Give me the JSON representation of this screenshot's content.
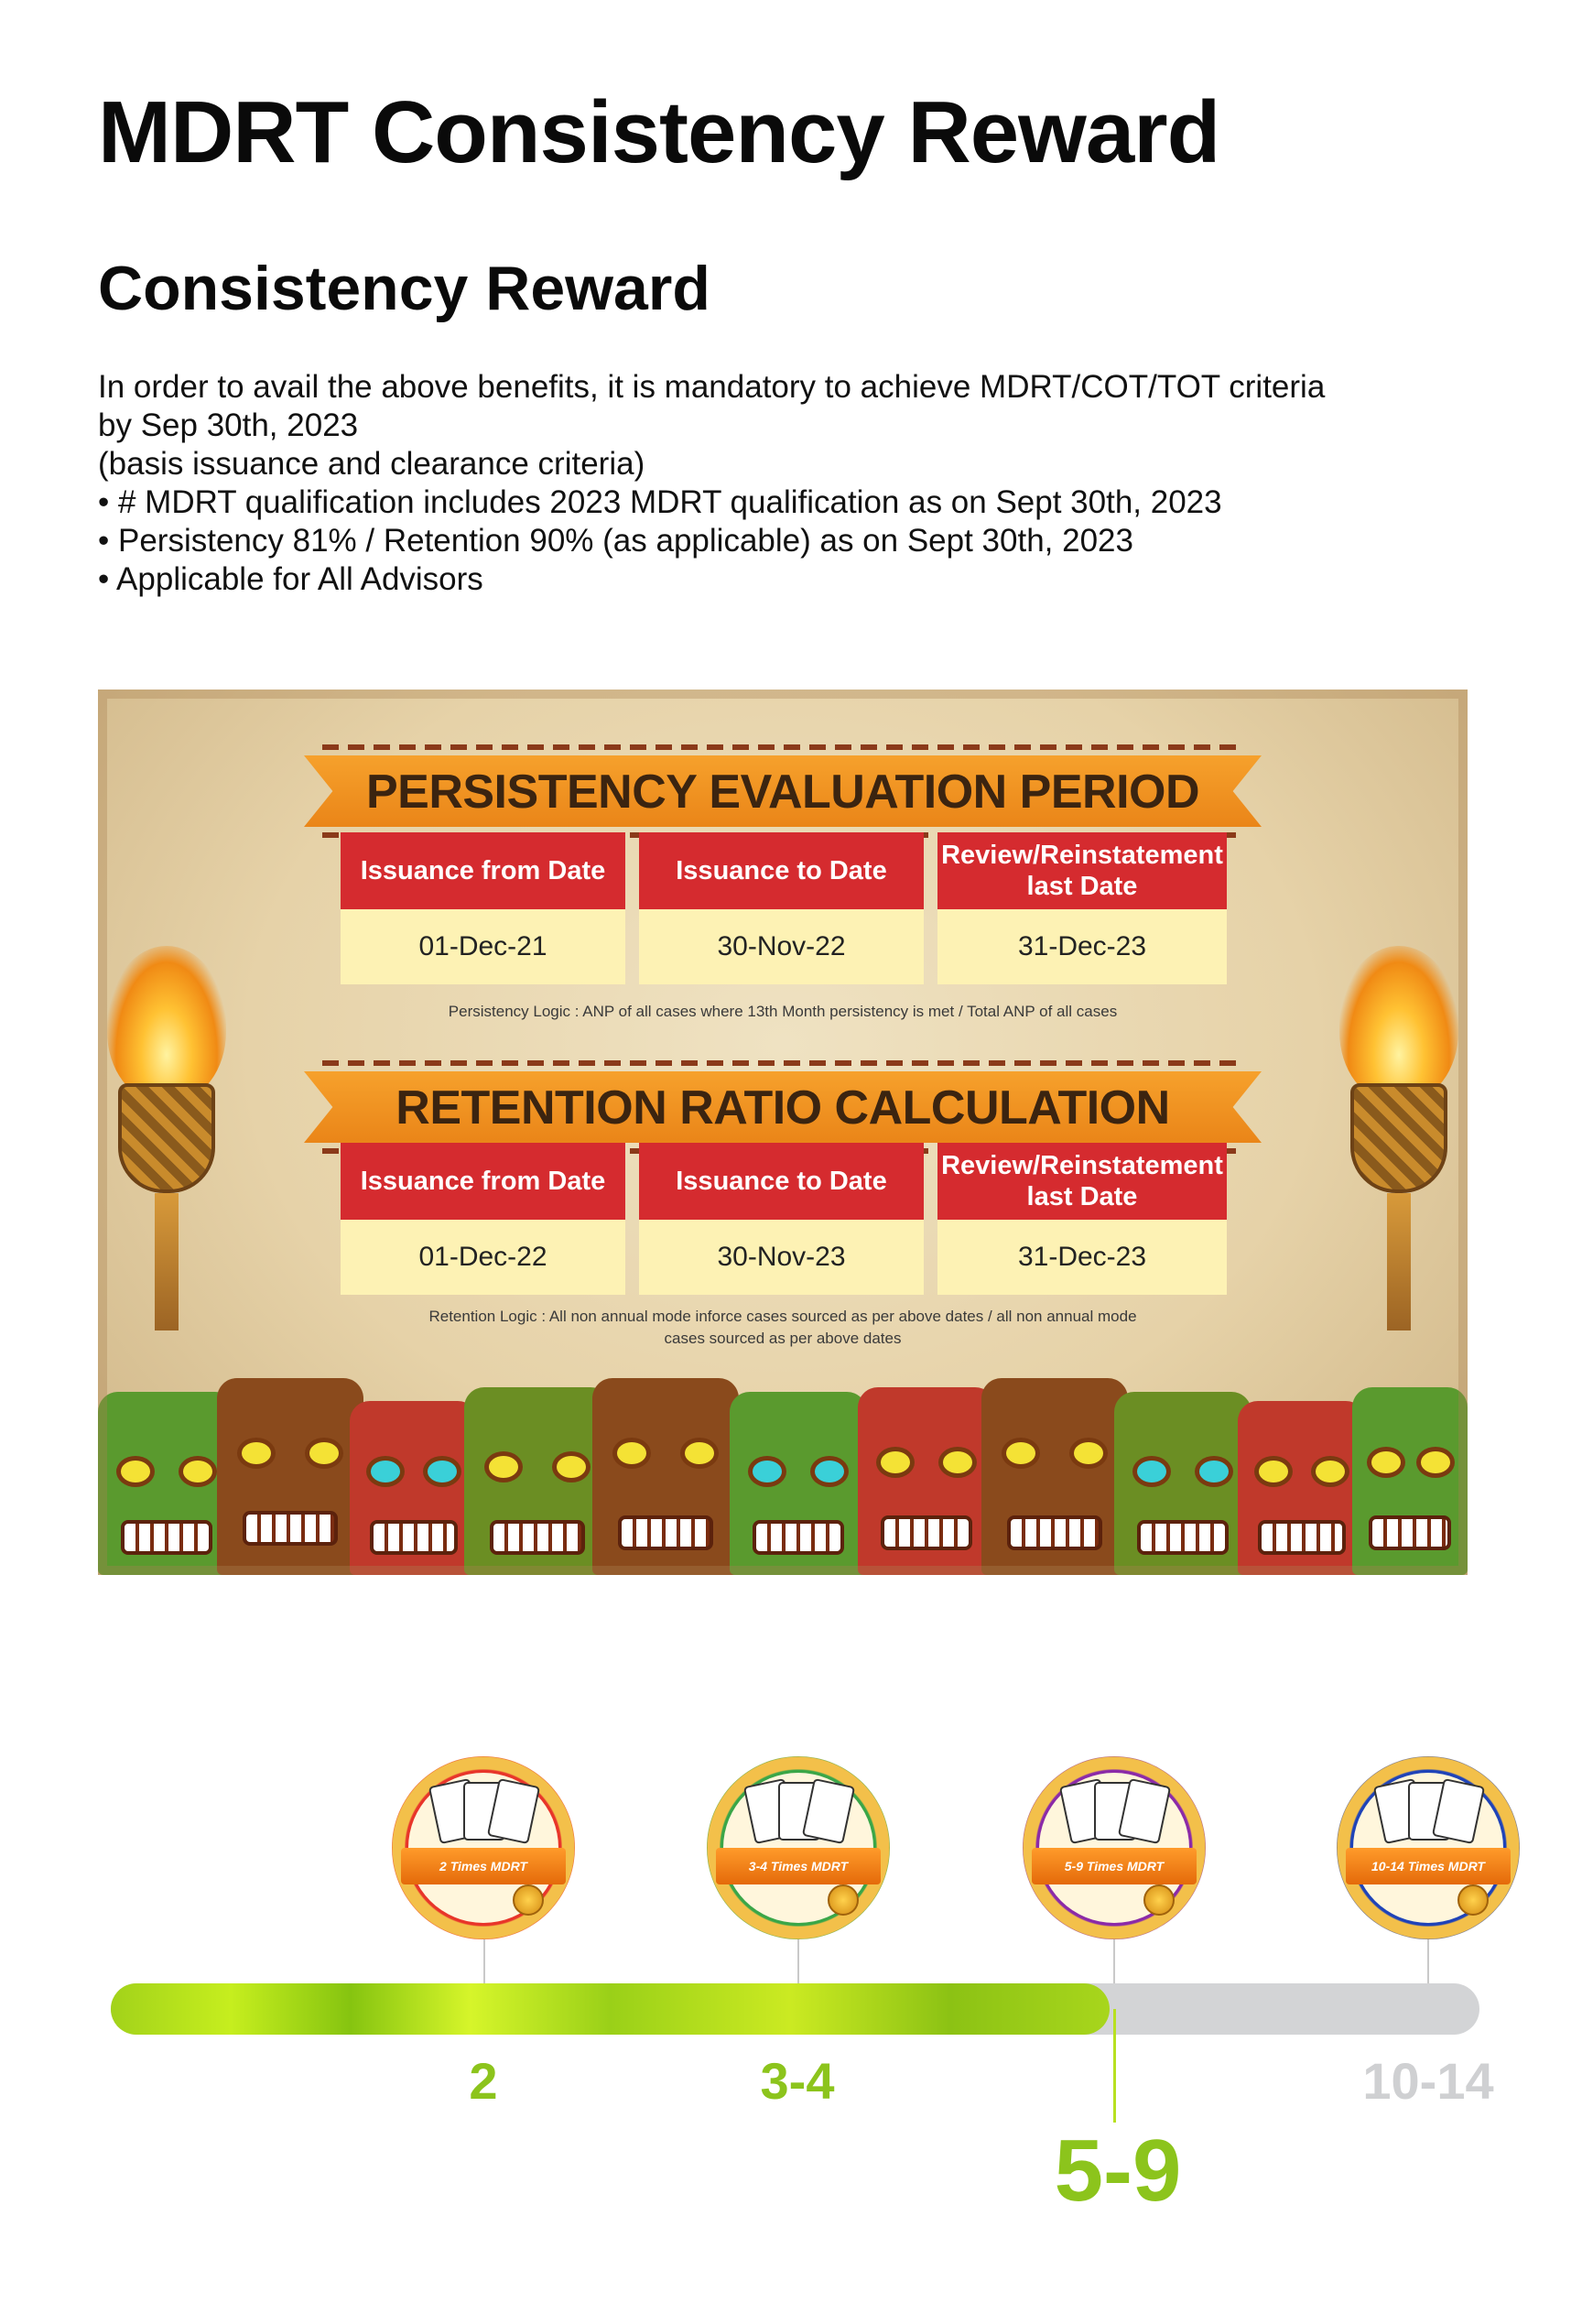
{
  "page": {
    "title": "MDRT Consistency Reward",
    "section_title": "Consistency Reward",
    "intro_lines": [
      "In order to avail the above benefits, it is mandatory to achieve MDRT/COT/TOT criteria",
      "by Sep 30th, 2023",
      "(basis issuance and clearance criteria)",
      "• # MDRT qualification includes 2023 MDRT qualification as on Sept 30th, 2023",
      "• Persistency 81% / Retention 90% (as applicable) as on Sept 30th, 2023",
      "• Applicable for All Advisors"
    ]
  },
  "banner": {
    "persistency": {
      "heading": "PERSISTENCY EVALUATION PERIOD",
      "headers": [
        "Issuance from Date",
        "Issuance to Date",
        "Review/Reinstatement last Date"
      ],
      "values": [
        "01-Dec-21",
        "30-Nov-22",
        "31-Dec-23"
      ],
      "logic": "Persistency Logic : ANP of all cases where 13th Month persistency is met / Total ANP of all cases"
    },
    "retention": {
      "heading": "RETENTION RATIO CALCULATION",
      "headers": [
        "Issuance from Date",
        "Issuance to Date",
        "Review/Reinstatement last Date"
      ],
      "values": [
        "01-Dec-22",
        "30-Nov-23",
        "31-Dec-23"
      ],
      "logic_lines": [
        "Retention Logic : All non annual mode inforce cases sourced as per above dates / all non annual mode",
        "cases sourced as per above dates"
      ]
    }
  },
  "timeline": {
    "badges": [
      {
        "label": "2 Times MDRT",
        "color": "#e8352a",
        "icon": "playing-cards-badge"
      },
      {
        "label": "3-4 Times MDRT",
        "color": "#3aa648",
        "icon": "playing-cards-badge"
      },
      {
        "label": "5-9 Times MDRT",
        "color": "#8b2aa8",
        "icon": "playing-cards-badge"
      },
      {
        "label": "10-14 Times MDRT",
        "color": "#1f43b8",
        "icon": "playing-cards-badge"
      }
    ],
    "milestones": [
      "2",
      "3-4",
      "5-9",
      "10-14"
    ],
    "current_milestone": "5-9",
    "progress_fraction": 0.73,
    "colors": {
      "active": "#8cc41c",
      "inactive": "#cfd0d2",
      "track": "#d3d4d6"
    }
  }
}
